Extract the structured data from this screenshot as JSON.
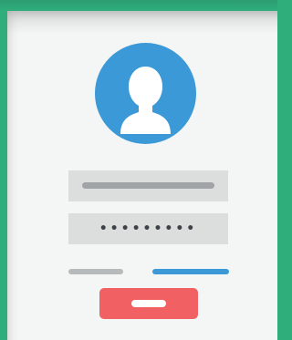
{
  "login_form": {
    "password_mask": "•••••••••"
  },
  "colors": {
    "frame_green": "#2fae7c",
    "card_background": "#f4f5f5",
    "avatar_blue": "#3b99d8",
    "field_gray": "#dcdddd",
    "accent_blue": "#3b99d8",
    "button_red": "#f16062"
  },
  "icons": {
    "avatar": "user-silhouette-icon"
  }
}
